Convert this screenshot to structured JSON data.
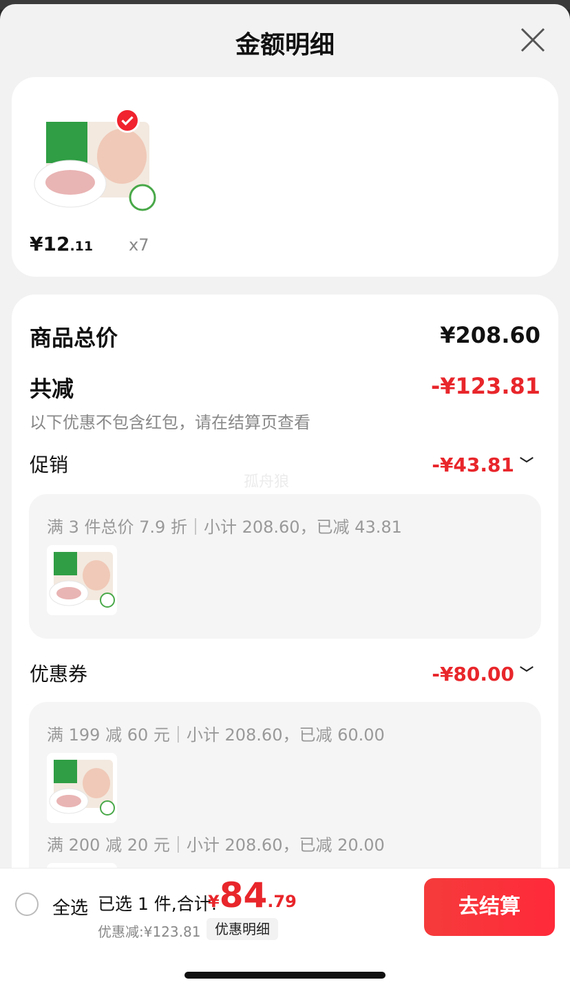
{
  "header": {
    "title": "金额明细"
  },
  "product": {
    "price_int": "¥12",
    "price_dec": ".11",
    "qty": "x7"
  },
  "summary": {
    "total_label": "商品总价",
    "total_value": "¥208.60",
    "reduce_label": "共减",
    "reduce_value": "-¥123.81",
    "note": "以下优惠不包含红包，请在结算页查看"
  },
  "promo": {
    "label": "促销",
    "value": "-¥43.81",
    "detail": "满 3 件总价 7.9 折｜小计 208.60，已减 43.81"
  },
  "coupon": {
    "label": "优惠券",
    "value": "-¥80.00",
    "detail1": "满 199 减 60 元｜小计 208.60，已减 60.00",
    "detail2": "满 200 减 20 元｜小计 208.60，已减 20.00"
  },
  "watermark": "孤舟狼",
  "footer": {
    "select_all": "全选",
    "selected_text": "已选 1 件,合计:",
    "total_symbol": "¥",
    "total_int": "84",
    "total_dec": ".79",
    "discount": "优惠减:¥123.81",
    "detail_button": "优惠明细",
    "checkout_button": "去结算"
  },
  "colors": {
    "accent_red": "#e8262b",
    "background": "#f2f2f2"
  },
  "icons": [
    "close-icon",
    "check-badge-icon",
    "chevron-down-icon",
    "radio-icon"
  ]
}
